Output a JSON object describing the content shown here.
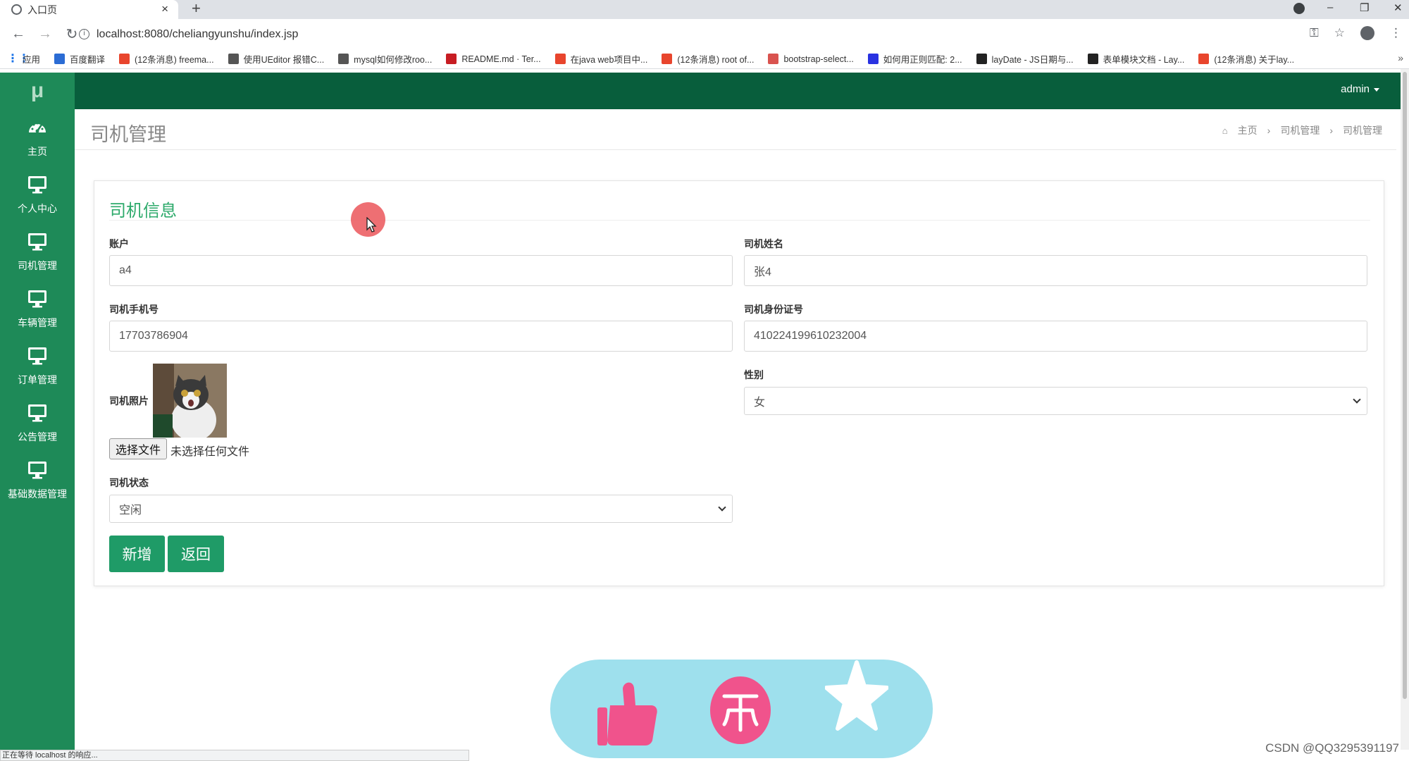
{
  "browser": {
    "tab_title": "入口页",
    "tab_close": "×",
    "new_tab": "+",
    "url": "localhost:8080/cheliangyunshu/index.jsp",
    "bookmarks": [
      {
        "label": "应用",
        "icon": "apps-grid-icon",
        "color": "#1a73e8"
      },
      {
        "label": "百度翻译",
        "icon": "translate-icon",
        "color": "#2b6cd4"
      },
      {
        "label": "(12条消息) freema...",
        "icon": "csdn-icon",
        "color": "#e8452d"
      },
      {
        "label": "使用UEditor 报错C...",
        "icon": "favicon-icon",
        "color": "#555555"
      },
      {
        "label": "mysql如何修改roo...",
        "icon": "favicon-icon",
        "color": "#555555"
      },
      {
        "label": "README.md · Ter...",
        "icon": "gitee-icon",
        "color": "#c71d23"
      },
      {
        "label": "在java web项目中...",
        "icon": "csdn-icon",
        "color": "#e8452d"
      },
      {
        "label": "(12条消息) root of...",
        "icon": "csdn-icon",
        "color": "#e8452d"
      },
      {
        "label": "bootstrap-select...",
        "icon": "doc-icon",
        "color": "#d9534f"
      },
      {
        "label": "如何用正则匹配: 2...",
        "icon": "baidu-icon",
        "color": "#2932e1"
      },
      {
        "label": "layDate - JS日期与...",
        "icon": "layui-icon",
        "color": "#222222"
      },
      {
        "label": "表单模块文档 - Lay...",
        "icon": "layui-icon",
        "color": "#222222"
      },
      {
        "label": "(12条消息) 关于lay...",
        "icon": "csdn-icon",
        "color": "#e8452d"
      }
    ],
    "bookmarks_more": "»",
    "status_text": "正在等待 localhost 的响应..."
  },
  "app": {
    "logo": "μ",
    "admin_label": "admin",
    "sidebar": [
      {
        "label": "主页",
        "icon": "dashboard-icon"
      },
      {
        "label": "个人中心",
        "icon": "monitor-icon"
      },
      {
        "label": "司机管理",
        "icon": "monitor-icon"
      },
      {
        "label": "车辆管理",
        "icon": "monitor-icon"
      },
      {
        "label": "订单管理",
        "icon": "monitor-icon"
      },
      {
        "label": "公告管理",
        "icon": "monitor-icon"
      },
      {
        "label": "基础数据管理",
        "icon": "monitor-icon"
      }
    ],
    "page_title": "司机管理",
    "breadcrumb": [
      "主页",
      "司机管理",
      "司机管理"
    ],
    "breadcrumb_sep": "›"
  },
  "form": {
    "title": "司机信息",
    "account_label": "账户",
    "account_value": "a4",
    "name_label": "司机姓名",
    "name_value": "张4",
    "phone_label": "司机手机号",
    "phone_value": "17703786904",
    "idcard_label": "司机身份证号",
    "idcard_value": "410224199610232004",
    "photo_label": "司机照片",
    "file_button": "选择文件",
    "file_status": "未选择任何文件",
    "gender_label": "性别",
    "gender_value": "女",
    "status_label": "司机状态",
    "status_value": "空闲",
    "submit_label": "新增",
    "back_label": "返回"
  },
  "colors": {
    "sidebar": "#1e8a58",
    "topbar": "#085e3c",
    "accent": "#2daa6b",
    "button": "#1f9b67",
    "overlay_pill": "#9ee0ed",
    "overlay_icons": "#f0538c"
  },
  "overlay": {
    "icons": [
      "thumbs-up-icon",
      "coin-icon",
      "star-icon"
    ]
  },
  "watermark": "CSDN @QQ3295391197"
}
